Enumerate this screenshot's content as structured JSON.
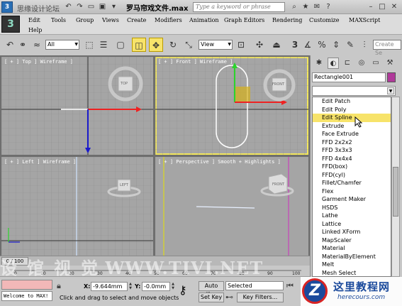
{
  "title_bar": {
    "watermark": "思缘设计论坛",
    "watermark_url": "www.MISSYUAN.COM",
    "file_name": "罗马帘戏文件.max",
    "search_placeholder": "Type a keyword or phrase"
  },
  "menu": {
    "items": [
      "Edit",
      "Tools",
      "Group",
      "Views",
      "Create",
      "Modifiers",
      "Animation",
      "Graph Editors",
      "Rendering",
      "Customize",
      "MAXScript",
      "Help"
    ]
  },
  "toolbar": {
    "selection_filter": "All",
    "reference_coord": "View",
    "snap_value": "3",
    "named_selection": "Create Se"
  },
  "viewports": {
    "top_label": "[ + ] Top ] Wireframe ]",
    "front_label": "[ + ] Front ] Wireframe ]",
    "left_label": "[ + ] Left ] Wireframe ]",
    "perspective_label": "[ + ] Perspective ] Smooth + Highlights ]",
    "viewcube_top": "TOP",
    "viewcube_front": "FRONT",
    "viewcube_left": "LEFT",
    "viewcube_persp": "FRONT"
  },
  "command_panel": {
    "object_name": "Rectangle001",
    "object_color": "#b0399a",
    "modifier_list": [
      "Edit Patch",
      "Edit Poly",
      "Edit Spline",
      "Extrude",
      "Face Extrude",
      "FFD 2x2x2",
      "FFD 3x3x3",
      "FFD 4x4x4",
      "FFD(box)",
      "FFD(cyl)",
      "Fillet/Chamfer",
      "Flex",
      "Garment Maker",
      "HSDS",
      "Lathe",
      "Lattice",
      "Linked XForm",
      "MapScaler",
      "Material",
      "MaterialByElement",
      "Melt",
      "Mesh Select"
    ],
    "selected_modifier": "Edit Spline"
  },
  "timeline": {
    "frame_display": "0 / 100",
    "ticks": [
      "0",
      "10",
      "20",
      "30",
      "40",
      "50",
      "60",
      "70",
      "80",
      "90",
      "100"
    ]
  },
  "status": {
    "maxscript_text": "Welcome to MAX!",
    "x_value": "-9.644mm",
    "y_value": "-0.0mm",
    "x_label": "X:",
    "y_label": "Y:",
    "prompt": "Click and drag to select and move objects",
    "auto_key": "Auto Key",
    "set_key": "Set Key",
    "key_mode": "Selected",
    "key_filters": "Key Filters..."
  },
  "overlay": {
    "watermark": "设 馆 视 觉  WWW.TIVI.NET",
    "site_cn": "这里教程网",
    "site_en": "herecours.com"
  }
}
